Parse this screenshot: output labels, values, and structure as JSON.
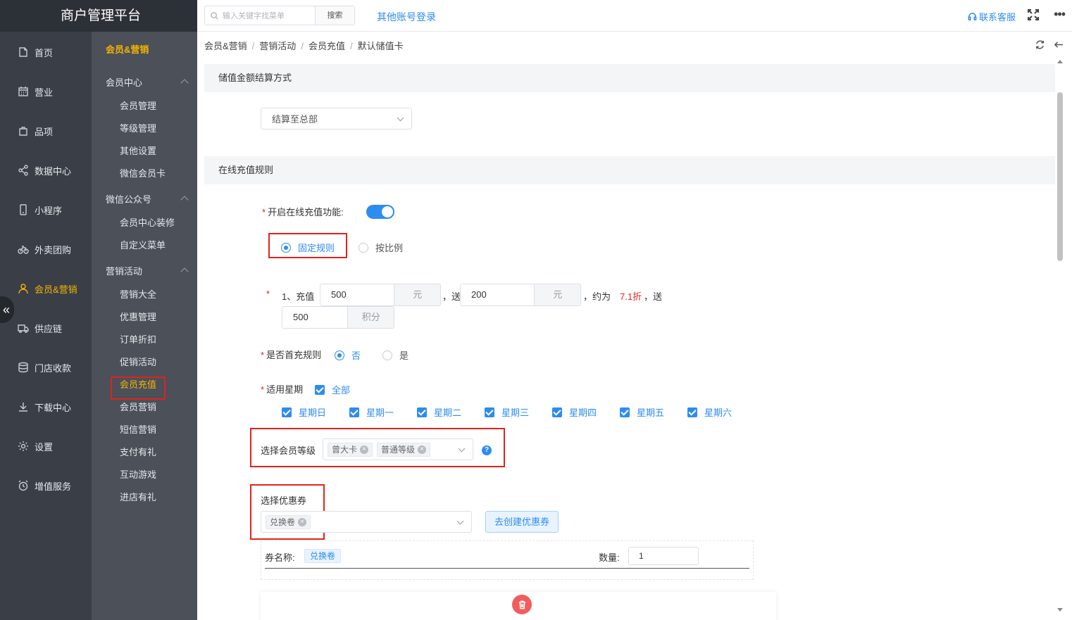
{
  "app": {
    "title": "商户管理平台"
  },
  "nav": [
    {
      "label": "首页",
      "icon": "home-icon"
    },
    {
      "label": "营业",
      "icon": "calendar-icon"
    },
    {
      "label": "品项",
      "icon": "bag-icon"
    },
    {
      "label": "数据中心",
      "icon": "share-icon"
    },
    {
      "label": "小程序",
      "icon": "phone-icon"
    },
    {
      "label": "外卖团购",
      "icon": "bike-icon"
    },
    {
      "label": "会员&营销",
      "icon": "user-icon",
      "active": true
    },
    {
      "label": "供应链",
      "icon": "truck-icon"
    },
    {
      "label": "门店收款",
      "icon": "database-icon"
    },
    {
      "label": "下载中心",
      "icon": "download-icon"
    },
    {
      "label": "设置",
      "icon": "gear-icon"
    },
    {
      "label": "增值服务",
      "icon": "alarm-icon"
    }
  ],
  "subnav": {
    "title": "会员&营销",
    "groups": [
      {
        "label": "会员中心",
        "items": [
          "会员管理",
          "等级管理",
          "其他设置",
          "微信会员卡"
        ]
      },
      {
        "label": "微信公众号",
        "items": [
          "会员中心装修",
          "自定义菜单"
        ]
      },
      {
        "label": "营销活动",
        "items": [
          "营销大全",
          "优惠管理",
          "订单折扣",
          "促销活动",
          "会员充值",
          "会员营销",
          "短信营销",
          "支付有礼",
          "互动游戏",
          "进店有礼"
        ]
      }
    ],
    "active_item": "会员充值"
  },
  "topbar": {
    "search_placeholder": "输入关键字找菜单",
    "search_button": "搜索",
    "other_login": "其他账号登录",
    "service": "联系客服",
    "more": "•••"
  },
  "breadcrumb": [
    "会员&营销",
    "营销活动",
    "会员充值",
    "默认储值卡"
  ],
  "section1": {
    "title": "储值金额结算方式",
    "settlement_value": "结算至总部"
  },
  "section2": {
    "title": "在线充值规则",
    "enable_label": "开启在线充值功能:",
    "enable_on": true,
    "rule_fixed": "固定规则",
    "rule_ratio": "按比例",
    "rule1": {
      "prefix": "1、充值",
      "amount": "500",
      "amount_unit": "元",
      "gift_prefix": "，送",
      "gift": "200",
      "gift_unit": "元",
      "approx_prefix": "，约为",
      "discount": "7.1折",
      "send_suffix": "，送",
      "points": "500",
      "points_unit": "积分"
    },
    "first_charge_label": "是否首充规则",
    "first_charge_no": "否",
    "first_charge_yes": "是",
    "weekday_label": "适用星期",
    "weekday_all": "全部",
    "weekdays": [
      "星期日",
      "星期一",
      "星期二",
      "星期三",
      "星期四",
      "星期五",
      "星期六"
    ],
    "member_level_label": "选择会员等级",
    "member_levels": [
      "曾大卡",
      "普通等级"
    ],
    "coupon_label": "选择优惠券",
    "coupons": [
      "兑换卷"
    ],
    "create_coupon": "去创建优惠券",
    "coupon_name_label": "券名称:",
    "coupon_name": "兑换卷",
    "quantity_label": "数量:",
    "quantity": "1"
  }
}
